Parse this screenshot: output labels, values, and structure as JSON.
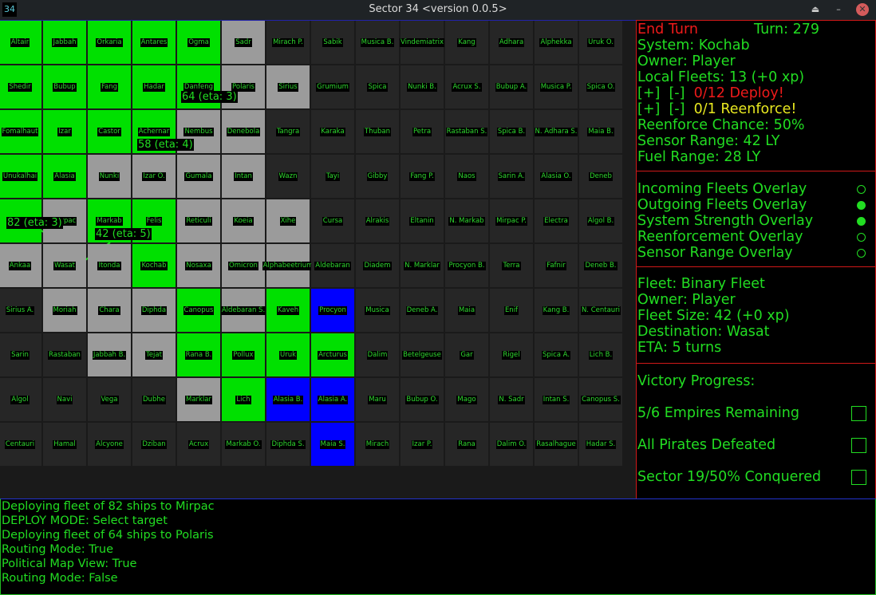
{
  "window": {
    "icon_text": "34",
    "title": "Sector 34   <version 0.0.5>",
    "eject_icon": "⏏",
    "minimize_icon": "–",
    "close_icon": "✕"
  },
  "colors": {
    "player": "#00e000",
    "neutral": "#9b9b9b",
    "unknown": "#262626",
    "enemy": "#0000ff"
  },
  "map": {
    "rows": [
      [
        [
          "Altair",
          "g"
        ],
        [
          "Jabbah",
          "g"
        ],
        [
          "Orkaria",
          "g"
        ],
        [
          "Antares",
          "g"
        ],
        [
          "Ogma",
          "g"
        ],
        [
          "Sadr",
          "n"
        ],
        [
          "Mirach P.",
          "d"
        ],
        [
          "Sabik",
          "d"
        ],
        [
          "Musica B.",
          "d"
        ],
        [
          "Vindemiatrix",
          "d"
        ],
        [
          "Kang",
          "d"
        ],
        [
          "Adhara",
          "d"
        ],
        [
          "Alphekka",
          "d"
        ],
        [
          "Uruk O.",
          "d"
        ]
      ],
      [
        [
          "Shedir",
          "g"
        ],
        [
          "Bubup",
          "g"
        ],
        [
          "Fang",
          "g"
        ],
        [
          "Hadar",
          "g"
        ],
        [
          "Danfeng",
          "g"
        ],
        [
          "Polaris",
          "n"
        ],
        [
          "Sirius",
          "n"
        ],
        [
          "Grumium",
          "d"
        ],
        [
          "Spica",
          "d"
        ],
        [
          "Nunki B.",
          "d"
        ],
        [
          "Acrux S.",
          "d"
        ],
        [
          "Bubup A.",
          "d"
        ],
        [
          "Musica P.",
          "d"
        ],
        [
          "Spica O.",
          "d"
        ]
      ],
      [
        [
          "Fomalhaut",
          "g"
        ],
        [
          "Izar",
          "g"
        ],
        [
          "Castor",
          "g"
        ],
        [
          "Achernar",
          "g"
        ],
        [
          "Nembus",
          "n"
        ],
        [
          "Denebola",
          "n"
        ],
        [
          "Tangra",
          "d"
        ],
        [
          "Karaka",
          "d"
        ],
        [
          "Thuban",
          "d"
        ],
        [
          "Petra",
          "d"
        ],
        [
          "Rastaban S.",
          "d"
        ],
        [
          "Spica B.",
          "d"
        ],
        [
          "N. Adhara S.",
          "d"
        ],
        [
          "Maia B.",
          "d"
        ]
      ],
      [
        [
          "Unukalhai",
          "g"
        ],
        [
          "Alasia",
          "g"
        ],
        [
          "Nunki",
          "n"
        ],
        [
          "Izar O.",
          "n"
        ],
        [
          "Gumala",
          "n"
        ],
        [
          "Intan",
          "n"
        ],
        [
          "Wazn",
          "d"
        ],
        [
          "Tayi",
          "d"
        ],
        [
          "Gibby",
          "d"
        ],
        [
          "Fang P.",
          "d"
        ],
        [
          "Naos",
          "d"
        ],
        [
          "Sarin A.",
          "d"
        ],
        [
          "Alasia O.",
          "d"
        ],
        [
          "Deneb",
          "d"
        ]
      ],
      [
        [
          "N",
          "g"
        ],
        [
          "Mirpac",
          "n"
        ],
        [
          "Markab",
          "g"
        ],
        [
          "Felis",
          "g"
        ],
        [
          "Reticuli",
          "n"
        ],
        [
          "Koeia",
          "n"
        ],
        [
          "Xihe",
          "n"
        ],
        [
          "Cursa",
          "d"
        ],
        [
          "Alrakis",
          "d"
        ],
        [
          "Eltanin",
          "d"
        ],
        [
          "N. Markab",
          "d"
        ],
        [
          "Mirpac P.",
          "d"
        ],
        [
          "Electra",
          "d"
        ],
        [
          "Algol B.",
          "d"
        ]
      ],
      [
        [
          "Ankaa",
          "n"
        ],
        [
          "Wasat",
          "n"
        ],
        [
          "Itonda",
          "n"
        ],
        [
          "Kochab",
          "g"
        ],
        [
          "Nosaxa",
          "n"
        ],
        [
          "Omicron",
          "n"
        ],
        [
          "Alphabeetrium",
          "n"
        ],
        [
          "Aldebaran",
          "d"
        ],
        [
          "Diadem",
          "d"
        ],
        [
          "N. Marklar",
          "d"
        ],
        [
          "Procyon B.",
          "d"
        ],
        [
          "Terra",
          "d"
        ],
        [
          "Fafnir",
          "d"
        ],
        [
          "Deneb B.",
          "d"
        ]
      ],
      [
        [
          "Sirius A.",
          "d"
        ],
        [
          "Moriah",
          "n"
        ],
        [
          "Chara",
          "n"
        ],
        [
          "Diphda",
          "n"
        ],
        [
          "Canopus",
          "g"
        ],
        [
          "Aldebaran S.",
          "n"
        ],
        [
          "Kaveh",
          "g"
        ],
        [
          "Procyon",
          "b"
        ],
        [
          "Musica",
          "d"
        ],
        [
          "Deneb A.",
          "d"
        ],
        [
          "Maia",
          "d"
        ],
        [
          "Enif",
          "d"
        ],
        [
          "Kang B.",
          "d"
        ],
        [
          "N. Centauri",
          "d"
        ]
      ],
      [
        [
          "Sarin",
          "d"
        ],
        [
          "Rastaban",
          "d"
        ],
        [
          "Jabbah B.",
          "n"
        ],
        [
          "Tejat",
          "n"
        ],
        [
          "Rana B.",
          "g"
        ],
        [
          "Pollux",
          "g"
        ],
        [
          "Uruk",
          "g"
        ],
        [
          "Arcturus",
          "g"
        ],
        [
          "Dalim",
          "d"
        ],
        [
          "Betelgeuse",
          "d"
        ],
        [
          "Gar",
          "d"
        ],
        [
          "Rigel",
          "d"
        ],
        [
          "Spica A.",
          "d"
        ],
        [
          "Lich B.",
          "d"
        ]
      ],
      [
        [
          "Algol",
          "d"
        ],
        [
          "Navi",
          "d"
        ],
        [
          "Vega",
          "d"
        ],
        [
          "Dubhe",
          "d"
        ],
        [
          "Marklar",
          "n"
        ],
        [
          "Lich",
          "g"
        ],
        [
          "Alasia B.",
          "b"
        ],
        [
          "Alasia A.",
          "b"
        ],
        [
          "Maru",
          "d"
        ],
        [
          "Bubup O.",
          "d"
        ],
        [
          "Mago",
          "d"
        ],
        [
          "N. Sadr",
          "d"
        ],
        [
          "Intan S.",
          "d"
        ],
        [
          "Canopus S.",
          "d"
        ]
      ],
      [
        [
          "Centauri",
          "d"
        ],
        [
          "Hamal",
          "d"
        ],
        [
          "Alcyone",
          "d"
        ],
        [
          "Dziban",
          "d"
        ],
        [
          "Acrux",
          "d"
        ],
        [
          "Markab O.",
          "d"
        ],
        [
          "Diphda S.",
          "d"
        ],
        [
          "Maia S.",
          "b"
        ],
        [
          "Mirach",
          "d"
        ],
        [
          "Izar P.",
          "d"
        ],
        [
          "Rana",
          "d"
        ],
        [
          "Dalim O.",
          "d"
        ],
        [
          "Rasalhague",
          "d"
        ],
        [
          "Hadar S.",
          " d"
        ]
      ]
    ],
    "fleets": [
      {
        "label": "64 (eta: 3)",
        "dest": "Polaris"
      },
      {
        "label": "58 (eta: 4)",
        "dest": "Nembus"
      },
      {
        "label": "82 (eta: 3)",
        "dest": "Mirpac"
      },
      {
        "label": "42 (eta: 5)",
        "dest": "Wasat"
      }
    ]
  },
  "system_panel": {
    "end_turn": "End Turn",
    "turn": "Turn: 279",
    "system": "System: Kochab",
    "owner": "Owner: Player",
    "local_fleets": "Local Fleets: 13 (+0 xp)",
    "plus": "[+]",
    "minus": "[-]",
    "deploy": "0/12 Deploy!",
    "reenforce": "0/1 Reenforce!",
    "reenforce_chance": "Reenforce Chance: 50%",
    "sensor_range": "Sensor Range: 42 LY",
    "fuel_range": "Fuel Range: 28 LY"
  },
  "overlays": [
    {
      "label": "Incoming Fleets Overlay",
      "on": false
    },
    {
      "label": "Outgoing Fleets Overlay",
      "on": true
    },
    {
      "label": "System Strength Overlay",
      "on": true
    },
    {
      "label": "Reenforcement Overlay",
      "on": false
    },
    {
      "label": "Sensor Range Overlay",
      "on": false
    }
  ],
  "fleet_panel": {
    "fleet": "Fleet: Binary Fleet",
    "owner": "Owner: Player",
    "size": "Fleet Size: 42 (+0 xp)",
    "destination": "Destination: Wasat",
    "eta": "ETA: 5 turns"
  },
  "victory": {
    "title": "Victory Progress:",
    "items": [
      {
        "label": "5/6 Empires Remaining",
        "checked": false
      },
      {
        "label": "All Pirates Defeated",
        "checked": false
      },
      {
        "label": "Sector 19/50% Conquered",
        "checked": false
      }
    ]
  },
  "log": [
    "Deploying fleet of 82 ships to Mirpac",
    "DEPLOY MODE: Select target",
    "Deploying fleet of 64 ships to Polaris",
    "Routing Mode: True",
    "Political Map View: True",
    "Routing Mode: False"
  ]
}
